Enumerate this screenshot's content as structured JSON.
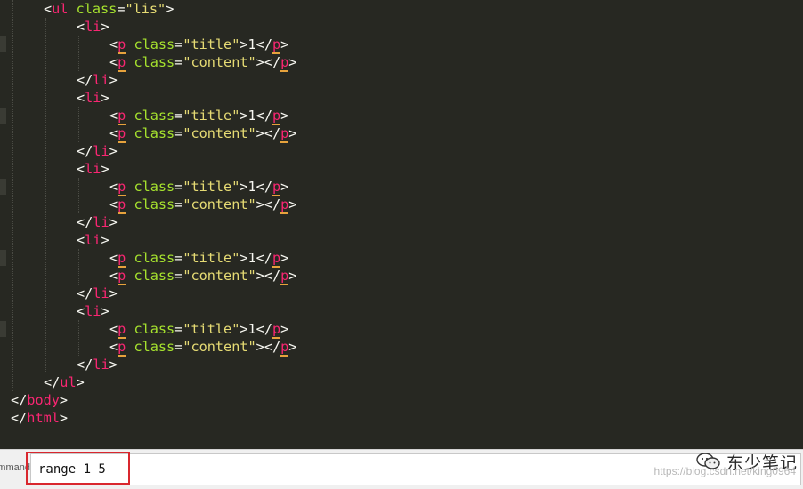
{
  "editor": {
    "lines": [
      {
        "indent": 4,
        "tokens": [
          [
            "punct",
            "<"
          ],
          [
            "tag",
            "ul"
          ],
          [
            "text",
            " "
          ],
          [
            "attr",
            "class"
          ],
          [
            "eq",
            "="
          ],
          [
            "str",
            "\"lis\""
          ],
          [
            "punct",
            ">"
          ]
        ]
      },
      {
        "indent": 8,
        "tokens": [
          [
            "punct",
            "<"
          ],
          [
            "tag",
            "li"
          ],
          [
            "punct",
            ">"
          ]
        ]
      },
      {
        "indent": 12,
        "tokens": [
          [
            "punct",
            "<"
          ],
          [
            "ptag",
            "p"
          ],
          [
            "text",
            " "
          ],
          [
            "attr",
            "class"
          ],
          [
            "eq",
            "="
          ],
          [
            "str",
            "\"title\""
          ],
          [
            "punct",
            ">"
          ],
          [
            "text",
            "1"
          ],
          [
            "punct",
            "</"
          ],
          [
            "ptag",
            "p"
          ],
          [
            "punct",
            ">"
          ]
        ]
      },
      {
        "indent": 12,
        "tokens": [
          [
            "punct",
            "<"
          ],
          [
            "ptag",
            "p"
          ],
          [
            "text",
            " "
          ],
          [
            "attr",
            "class"
          ],
          [
            "eq",
            "="
          ],
          [
            "str",
            "\"content\""
          ],
          [
            "punct",
            ">"
          ],
          [
            "punct",
            "</"
          ],
          [
            "ptag",
            "p"
          ],
          [
            "punct",
            ">"
          ]
        ]
      },
      {
        "indent": 8,
        "tokens": [
          [
            "punct",
            "</"
          ],
          [
            "tag",
            "li"
          ],
          [
            "punct",
            ">"
          ]
        ]
      },
      {
        "indent": 8,
        "tokens": [
          [
            "punct",
            "<"
          ],
          [
            "tag",
            "li"
          ],
          [
            "punct",
            ">"
          ]
        ]
      },
      {
        "indent": 12,
        "tokens": [
          [
            "punct",
            "<"
          ],
          [
            "ptag",
            "p"
          ],
          [
            "text",
            " "
          ],
          [
            "attr",
            "class"
          ],
          [
            "eq",
            "="
          ],
          [
            "str",
            "\"title\""
          ],
          [
            "punct",
            ">"
          ],
          [
            "text",
            "1"
          ],
          [
            "punct",
            "</"
          ],
          [
            "ptag",
            "p"
          ],
          [
            "punct",
            ">"
          ]
        ]
      },
      {
        "indent": 12,
        "tokens": [
          [
            "punct",
            "<"
          ],
          [
            "ptag",
            "p"
          ],
          [
            "text",
            " "
          ],
          [
            "attr",
            "class"
          ],
          [
            "eq",
            "="
          ],
          [
            "str",
            "\"content\""
          ],
          [
            "punct",
            ">"
          ],
          [
            "punct",
            "</"
          ],
          [
            "ptag",
            "p"
          ],
          [
            "punct",
            ">"
          ]
        ]
      },
      {
        "indent": 8,
        "tokens": [
          [
            "punct",
            "</"
          ],
          [
            "tag",
            "li"
          ],
          [
            "punct",
            ">"
          ]
        ]
      },
      {
        "indent": 8,
        "tokens": [
          [
            "punct",
            "<"
          ],
          [
            "tag",
            "li"
          ],
          [
            "punct",
            ">"
          ]
        ]
      },
      {
        "indent": 12,
        "tokens": [
          [
            "punct",
            "<"
          ],
          [
            "ptag",
            "p"
          ],
          [
            "text",
            " "
          ],
          [
            "attr",
            "class"
          ],
          [
            "eq",
            "="
          ],
          [
            "str",
            "\"title\""
          ],
          [
            "punct",
            ">"
          ],
          [
            "text",
            "1"
          ],
          [
            "punct",
            "</"
          ],
          [
            "ptag",
            "p"
          ],
          [
            "punct",
            ">"
          ]
        ]
      },
      {
        "indent": 12,
        "tokens": [
          [
            "punct",
            "<"
          ],
          [
            "ptag",
            "p"
          ],
          [
            "text",
            " "
          ],
          [
            "attr",
            "class"
          ],
          [
            "eq",
            "="
          ],
          [
            "str",
            "\"content\""
          ],
          [
            "punct",
            ">"
          ],
          [
            "punct",
            "</"
          ],
          [
            "ptag",
            "p"
          ],
          [
            "punct",
            ">"
          ]
        ]
      },
      {
        "indent": 8,
        "tokens": [
          [
            "punct",
            "</"
          ],
          [
            "tag",
            "li"
          ],
          [
            "punct",
            ">"
          ]
        ]
      },
      {
        "indent": 8,
        "tokens": [
          [
            "punct",
            "<"
          ],
          [
            "tag",
            "li"
          ],
          [
            "punct",
            ">"
          ]
        ]
      },
      {
        "indent": 12,
        "tokens": [
          [
            "punct",
            "<"
          ],
          [
            "ptag",
            "p"
          ],
          [
            "text",
            " "
          ],
          [
            "attr",
            "class"
          ],
          [
            "eq",
            "="
          ],
          [
            "str",
            "\"title\""
          ],
          [
            "punct",
            ">"
          ],
          [
            "text",
            "1"
          ],
          [
            "punct",
            "</"
          ],
          [
            "ptag",
            "p"
          ],
          [
            "punct",
            ">"
          ]
        ]
      },
      {
        "indent": 12,
        "tokens": [
          [
            "punct",
            "<"
          ],
          [
            "ptag",
            "p"
          ],
          [
            "text",
            " "
          ],
          [
            "attr",
            "class"
          ],
          [
            "eq",
            "="
          ],
          [
            "str",
            "\"content\""
          ],
          [
            "punct",
            ">"
          ],
          [
            "punct",
            "</"
          ],
          [
            "ptag",
            "p"
          ],
          [
            "punct",
            ">"
          ]
        ]
      },
      {
        "indent": 8,
        "tokens": [
          [
            "punct",
            "</"
          ],
          [
            "tag",
            "li"
          ],
          [
            "punct",
            ">"
          ]
        ]
      },
      {
        "indent": 8,
        "tokens": [
          [
            "punct",
            "<"
          ],
          [
            "tag",
            "li"
          ],
          [
            "punct",
            ">"
          ]
        ]
      },
      {
        "indent": 12,
        "tokens": [
          [
            "punct",
            "<"
          ],
          [
            "ptag",
            "p"
          ],
          [
            "text",
            " "
          ],
          [
            "attr",
            "class"
          ],
          [
            "eq",
            "="
          ],
          [
            "str",
            "\"title\""
          ],
          [
            "punct",
            ">"
          ],
          [
            "text",
            "1"
          ],
          [
            "punct",
            "</"
          ],
          [
            "ptag",
            "p"
          ],
          [
            "punct",
            ">"
          ]
        ]
      },
      {
        "indent": 12,
        "tokens": [
          [
            "punct",
            "<"
          ],
          [
            "ptag",
            "p"
          ],
          [
            "text",
            " "
          ],
          [
            "attr",
            "class"
          ],
          [
            "eq",
            "="
          ],
          [
            "str",
            "\"content\""
          ],
          [
            "punct",
            ">"
          ],
          [
            "punct",
            "</"
          ],
          [
            "ptag",
            "p"
          ],
          [
            "punct",
            ">"
          ]
        ]
      },
      {
        "indent": 8,
        "tokens": [
          [
            "punct",
            "</"
          ],
          [
            "tag",
            "li"
          ],
          [
            "punct",
            ">"
          ]
        ]
      },
      {
        "indent": 4,
        "tokens": [
          [
            "punct",
            "</"
          ],
          [
            "tag",
            "ul"
          ],
          [
            "punct",
            ">"
          ]
        ]
      },
      {
        "indent": 0,
        "tokens": [
          [
            "punct",
            "</"
          ],
          [
            "tag",
            "body"
          ],
          [
            "punct",
            ">"
          ]
        ]
      },
      {
        "indent": 0,
        "tokens": [
          [
            "punct",
            "</"
          ],
          [
            "tag",
            "html"
          ],
          [
            "punct",
            ">"
          ]
        ]
      }
    ],
    "colors": {
      "background": "#272822",
      "tag": "#f92672",
      "attribute": "#a6e22e",
      "string": "#e6db74",
      "text": "#f8f8f2",
      "p_tag_underline": "#e6a23c"
    }
  },
  "command_bar": {
    "label": "Command:",
    "value": "range 1 5",
    "highlight_color": "#d9272e"
  },
  "watermark": {
    "logo_icon": "wechat-icon",
    "brand": "东少笔记",
    "url": "https://blog.csdn.net/king0964"
  }
}
